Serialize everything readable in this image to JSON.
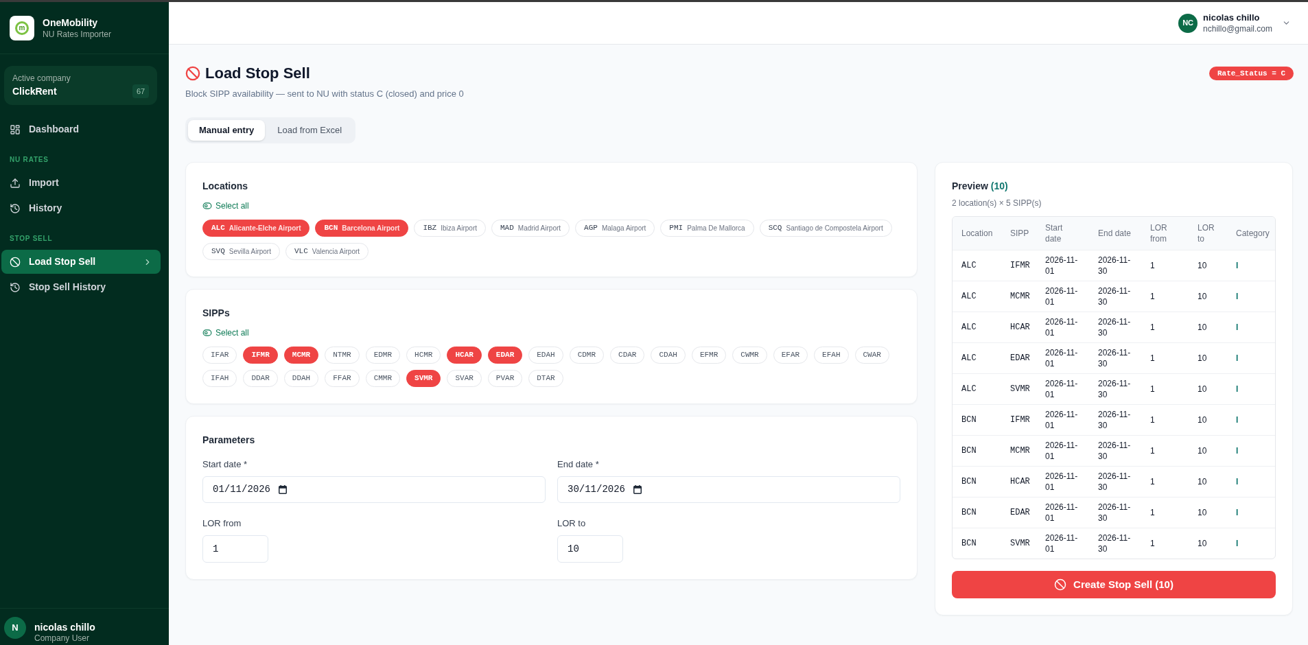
{
  "sidebar": {
    "brand": {
      "logo": "m",
      "name": "OneMobility",
      "subtitle": "NU Rates Importer"
    },
    "company": {
      "label": "Active company",
      "name": "ClickRent",
      "count": "67"
    },
    "nav": [
      {
        "items": [
          {
            "label": "Dashboard",
            "selected": false
          }
        ]
      },
      {
        "heading": "NU RATES",
        "items": [
          {
            "label": "Import",
            "selected": false
          },
          {
            "label": "History",
            "selected": false
          }
        ]
      },
      {
        "heading": "STOP SELL",
        "items": [
          {
            "label": "Load Stop Sell",
            "selected": true
          },
          {
            "label": "Stop Sell History",
            "selected": false
          }
        ]
      }
    ],
    "user": {
      "initial": "N",
      "name": "nicolas chillo",
      "role": "Company User"
    }
  },
  "header": {
    "user": {
      "initials": "NC",
      "name": "nicolas chillo",
      "email": "nchillo@gmail.com"
    }
  },
  "page": {
    "title": "Load Stop Sell",
    "subtitle": "Block SIPP availability — sent to NU with status C (closed) and price 0",
    "badge": "Rate_Status = C"
  },
  "tabs": [
    {
      "label": "Manual entry",
      "selected": true
    },
    {
      "label": "Load from Excel",
      "selected": false
    }
  ],
  "locations": {
    "title": "Locations",
    "select_all": "Select all",
    "items": [
      {
        "code": "ALC",
        "name": "Alicante-Elche Airport",
        "selected": true
      },
      {
        "code": "BCN",
        "name": "Barcelona Airport",
        "selected": true
      },
      {
        "code": "IBZ",
        "name": "Ibiza Airport",
        "selected": false
      },
      {
        "code": "MAD",
        "name": "Madrid Airport",
        "selected": false
      },
      {
        "code": "AGP",
        "name": "Malaga Airport",
        "selected": false
      },
      {
        "code": "PMI",
        "name": "Palma De Mallorca",
        "selected": false
      },
      {
        "code": "SCQ",
        "name": "Santiago de Compostela Airport",
        "selected": false
      },
      {
        "code": "SVQ",
        "name": "Sevilla Airport",
        "selected": false
      },
      {
        "code": "VLC",
        "name": "Valencia Airport",
        "selected": false
      }
    ]
  },
  "sipps": {
    "title": "SIPPs",
    "select_all": "Select all",
    "items": [
      {
        "code": "IFAR",
        "selected": false
      },
      {
        "code": "IFMR",
        "selected": true
      },
      {
        "code": "MCMR",
        "selected": true
      },
      {
        "code": "NTMR",
        "selected": false
      },
      {
        "code": "EDMR",
        "selected": false
      },
      {
        "code": "HCMR",
        "selected": false
      },
      {
        "code": "HCAR",
        "selected": true
      },
      {
        "code": "EDAR",
        "selected": true
      },
      {
        "code": "EDAH",
        "selected": false
      },
      {
        "code": "CDMR",
        "selected": false
      },
      {
        "code": "CDAR",
        "selected": false
      },
      {
        "code": "CDAH",
        "selected": false
      },
      {
        "code": "EFMR",
        "selected": false
      },
      {
        "code": "CWMR",
        "selected": false
      },
      {
        "code": "EFAR",
        "selected": false
      },
      {
        "code": "EFAH",
        "selected": false
      },
      {
        "code": "CWAR",
        "selected": false
      },
      {
        "code": "IFAH",
        "selected": false
      },
      {
        "code": "DDAR",
        "selected": false
      },
      {
        "code": "DDAH",
        "selected": false
      },
      {
        "code": "FFAR",
        "selected": false
      },
      {
        "code": "CMMR",
        "selected": false
      },
      {
        "code": "SVMR",
        "selected": true
      },
      {
        "code": "SVAR",
        "selected": false
      },
      {
        "code": "PVAR",
        "selected": false
      },
      {
        "code": "DTAR",
        "selected": false
      }
    ]
  },
  "parameters": {
    "title": "Parameters",
    "fields": [
      {
        "label": "Start date *",
        "value": "01/11/2026",
        "kind": "date"
      },
      {
        "label": "End date *",
        "value": "30/11/2026",
        "kind": "date"
      },
      {
        "label": "LOR from",
        "value": "1",
        "kind": "number"
      },
      {
        "label": "LOR to",
        "value": "10",
        "kind": "number"
      }
    ]
  },
  "preview": {
    "title": "Preview",
    "count": "(10)",
    "summary": "2 location(s) × 5 SIPP(s)",
    "columns": [
      "Location",
      "SIPP",
      "Start date",
      "End date",
      "LOR from",
      "LOR to",
      "Category"
    ],
    "rows": [
      {
        "location": "ALC",
        "sipp": "IFMR",
        "start_date": "2026-11-01",
        "end_date": "2026-11-30",
        "lor_from": "1",
        "lor_to": "10",
        "category": "I"
      },
      {
        "location": "ALC",
        "sipp": "MCMR",
        "start_date": "2026-11-01",
        "end_date": "2026-11-30",
        "lor_from": "1",
        "lor_to": "10",
        "category": "I"
      },
      {
        "location": "ALC",
        "sipp": "HCAR",
        "start_date": "2026-11-01",
        "end_date": "2026-11-30",
        "lor_from": "1",
        "lor_to": "10",
        "category": "I"
      },
      {
        "location": "ALC",
        "sipp": "EDAR",
        "start_date": "2026-11-01",
        "end_date": "2026-11-30",
        "lor_from": "1",
        "lor_to": "10",
        "category": "I"
      },
      {
        "location": "ALC",
        "sipp": "SVMR",
        "start_date": "2026-11-01",
        "end_date": "2026-11-30",
        "lor_from": "1",
        "lor_to": "10",
        "category": "I"
      },
      {
        "location": "BCN",
        "sipp": "IFMR",
        "start_date": "2026-11-01",
        "end_date": "2026-11-30",
        "lor_from": "1",
        "lor_to": "10",
        "category": "I"
      },
      {
        "location": "BCN",
        "sipp": "MCMR",
        "start_date": "2026-11-01",
        "end_date": "2026-11-30",
        "lor_from": "1",
        "lor_to": "10",
        "category": "I"
      },
      {
        "location": "BCN",
        "sipp": "HCAR",
        "start_date": "2026-11-01",
        "end_date": "2026-11-30",
        "lor_from": "1",
        "lor_to": "10",
        "category": "I"
      },
      {
        "location": "BCN",
        "sipp": "EDAR",
        "start_date": "2026-11-01",
        "end_date": "2026-11-30",
        "lor_from": "1",
        "lor_to": "10",
        "category": "I"
      },
      {
        "location": "BCN",
        "sipp": "SVMR",
        "start_date": "2026-11-01",
        "end_date": "2026-11-30",
        "lor_from": "1",
        "lor_to": "10",
        "category": "I"
      }
    ],
    "button": "Create Stop Sell (10)"
  }
}
